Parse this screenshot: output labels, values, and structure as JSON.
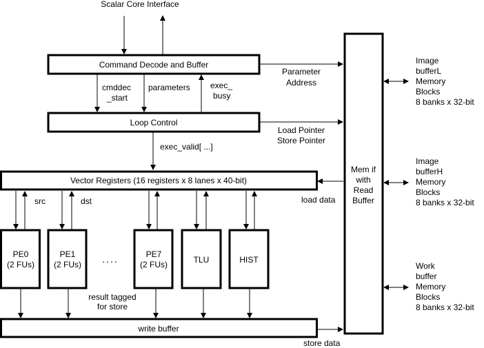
{
  "scalar_core_interface": "Scalar Core Interface",
  "blocks": {
    "command_decode": "Command Decode and Buffer",
    "loop_control": "Loop Control",
    "vector_registers": "Vector Registers (16 registers x 8 lanes x 40-bit)",
    "write_buffer": "write buffer",
    "mem_if": [
      "Mem if",
      "with",
      "Read",
      "Buffer"
    ],
    "pe0": [
      "PE0",
      "(2 FUs)"
    ],
    "pe1": [
      "PE1",
      "(2 FUs)"
    ],
    "pe7": [
      "PE7",
      "(2 FUs)"
    ],
    "tlu": "TLU",
    "hist": "HIST",
    "ellipsis": "...."
  },
  "signals": {
    "cmddec_start": [
      "cmddec",
      "_start"
    ],
    "parameters": "parameters",
    "exec_busy": [
      "exec_",
      "busy"
    ],
    "parameter_address": [
      "Parameter",
      "Address"
    ],
    "pointers": [
      "Load Pointer",
      "Store Pointer"
    ],
    "exec_valid": "exec_valid[ ...]",
    "src": "src",
    "dst": "dst",
    "load_data": "load data",
    "store_data": "store data",
    "result_tagged": [
      "result tagged",
      "for store"
    ]
  },
  "memories": [
    [
      "Image",
      "bufferL",
      "Memory",
      "Blocks",
      "8 banks x 32-bit"
    ],
    [
      "Image",
      "bufferH",
      "Memory",
      "Blocks",
      "8 banks x 32-bit"
    ],
    [
      "Work",
      "buffer",
      "Memory",
      "Blocks",
      "8 banks x 32-bit"
    ]
  ]
}
